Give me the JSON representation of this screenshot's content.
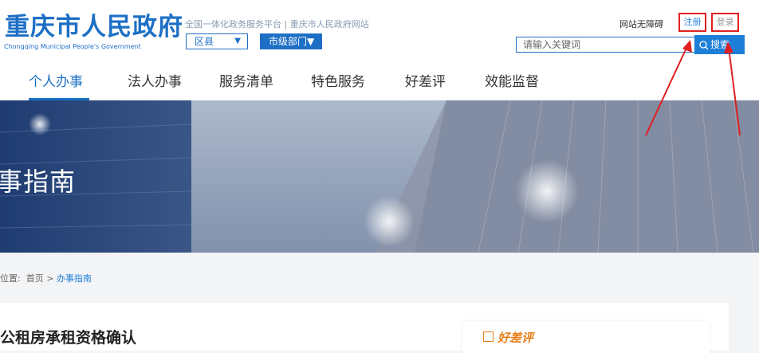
{
  "header": {
    "logo_title": "重庆市人民政府",
    "logo_subtitle": "Chongqing Municipal People's Government",
    "platform_text": "全国一体化政务服务平台 | 重庆市人民政府网站",
    "county_select": "区县",
    "dept_select": "市级部门▼",
    "accessibility": "网站无障碍",
    "register": "注册",
    "login": "登录",
    "search_placeholder": "请输入关键词",
    "search_button": "搜索"
  },
  "nav": {
    "items": [
      "个人办事",
      "法人办事",
      "服务清单",
      "特色服务",
      "好差评",
      "效能监督"
    ],
    "active": "个人办事"
  },
  "banner": {
    "title": "事指南"
  },
  "breadcrumb": {
    "prefix": "位置:",
    "home": "首页",
    "sep": ">",
    "current": "办事指南"
  },
  "main": {
    "title": "公租房承租资格确认"
  },
  "sidebar": {
    "rating_label": "好差评"
  },
  "colors": {
    "brand": "#1d6fc5",
    "accent_red": "#e02020",
    "rating_orange": "#e8801a"
  }
}
